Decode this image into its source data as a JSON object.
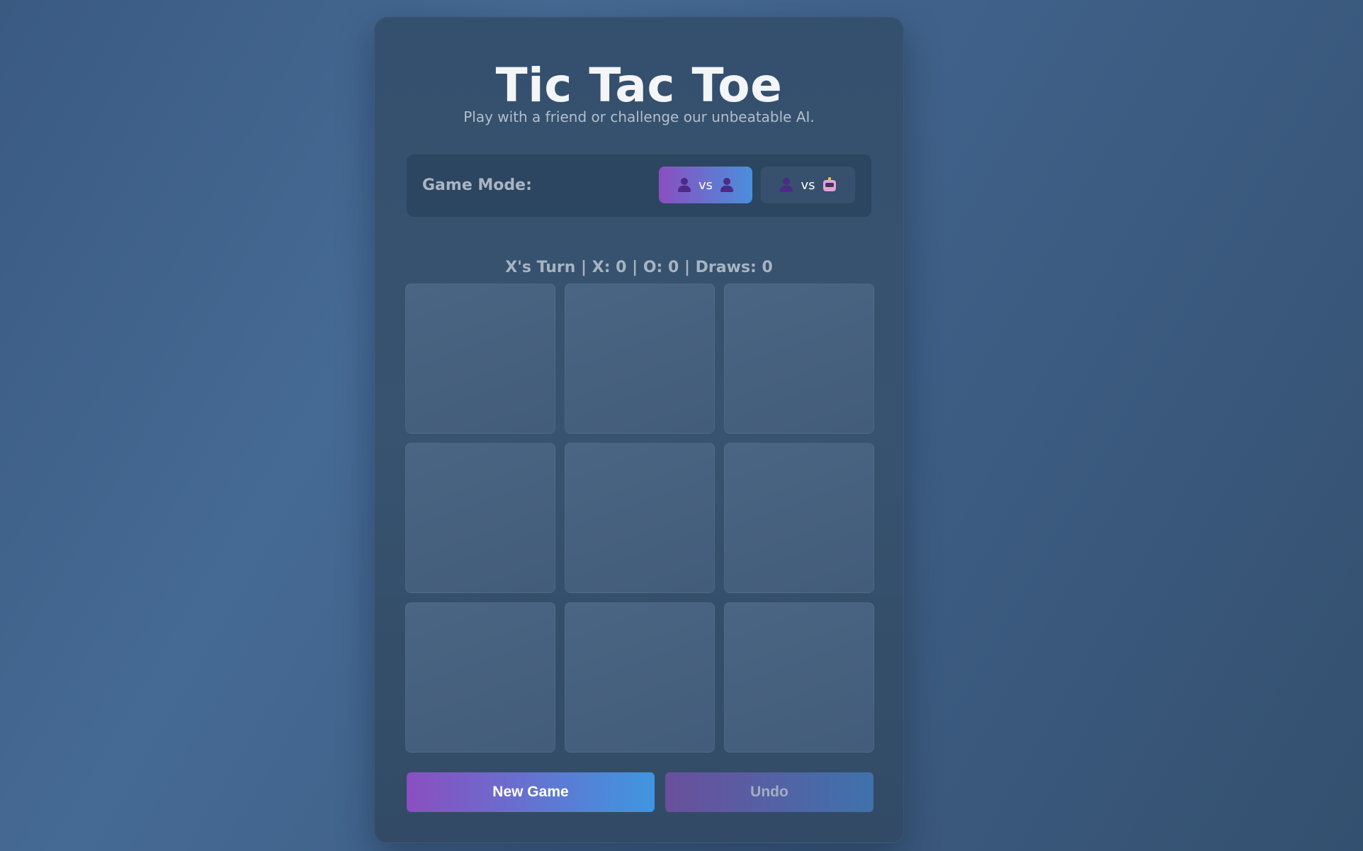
{
  "header": {
    "title": "Tic Tac Toe",
    "subtitle": "Play with a friend or challenge our unbeatable AI."
  },
  "mode": {
    "label": "Game Mode:",
    "options": [
      {
        "id": "pvp",
        "left_icon": "person-icon",
        "vs_text": "vs",
        "right_icon": "person-icon",
        "selected": true
      },
      {
        "id": "pva",
        "left_icon": "person-icon",
        "vs_text": "vs",
        "right_icon": "robot-icon",
        "selected": false
      }
    ]
  },
  "status": {
    "text": "X's Turn | X: 0 | O: 0 | Draws: 0"
  },
  "board": {
    "cells": [
      "",
      "",
      "",
      "",
      "",
      "",
      "",
      "",
      ""
    ]
  },
  "actions": {
    "new_game_label": "New Game",
    "undo_label": "Undo",
    "undo_enabled": false
  },
  "colors": {
    "accent_start": "#8a4fc0",
    "accent_end": "#3f96e0",
    "background": "#3f6088"
  }
}
